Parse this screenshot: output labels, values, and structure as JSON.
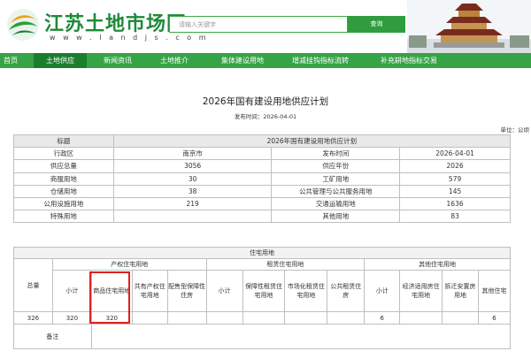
{
  "header": {
    "site_title": "江苏土地市场网",
    "site_url": "w w w . l a n d j s . c o m",
    "search_placeholder": "请输入关键字",
    "search_button": "查询"
  },
  "nav": {
    "items": [
      "首页",
      "土地供应",
      "新闻资讯",
      "土地推介",
      "集体建设用地",
      "增减挂钩指标流转",
      "补充耕地指标交易"
    ],
    "active_index": 1
  },
  "colors": {
    "brand_green": "#36a346",
    "active_green": "#1d7d2e",
    "highlight_red": "#e02020"
  },
  "doc": {
    "title": "2026年国有建设用地供应计划",
    "publish_time": "发布时间：2026-04-01",
    "unit": "单位：公顷"
  },
  "summary_table": {
    "header": [
      "标题",
      "2026年国有建设用地供应计划"
    ],
    "rows": [
      [
        "行政区",
        "南京市",
        "发布时间",
        "2026-04-01"
      ],
      [
        "供应总量",
        "3056",
        "供应年份",
        "2026"
      ],
      [
        "商服用地",
        "30",
        "工矿用地",
        "579"
      ],
      [
        "仓储用地",
        "38",
        "公共管理与公共服务用地",
        "145"
      ],
      [
        "公用设施用地",
        "219",
        "交通运输用地",
        "1636"
      ],
      [
        "特殊用地",
        "",
        "其他用地",
        "83"
      ]
    ]
  },
  "housing_table": {
    "title": "住宅用地",
    "total_label": "总量",
    "groups": [
      "产权住宅用地",
      "租赁住宅用地",
      "其他住宅用地"
    ],
    "subheads": [
      "小计",
      "商品住宅用地",
      "共有产权住宅用地",
      "配售型保障性住房",
      "小计",
      "保障性租赁住宅用地",
      "市场化租赁住宅用地",
      "公共租赁住房",
      "小计",
      "经济适用房住宅用地",
      "拆迁安置房用地",
      "其他住宅"
    ],
    "values": [
      "326",
      "320",
      "320",
      "",
      "",
      "",
      "",
      "",
      "",
      "6",
      "",
      "",
      "6"
    ],
    "remark_label": "备注"
  }
}
